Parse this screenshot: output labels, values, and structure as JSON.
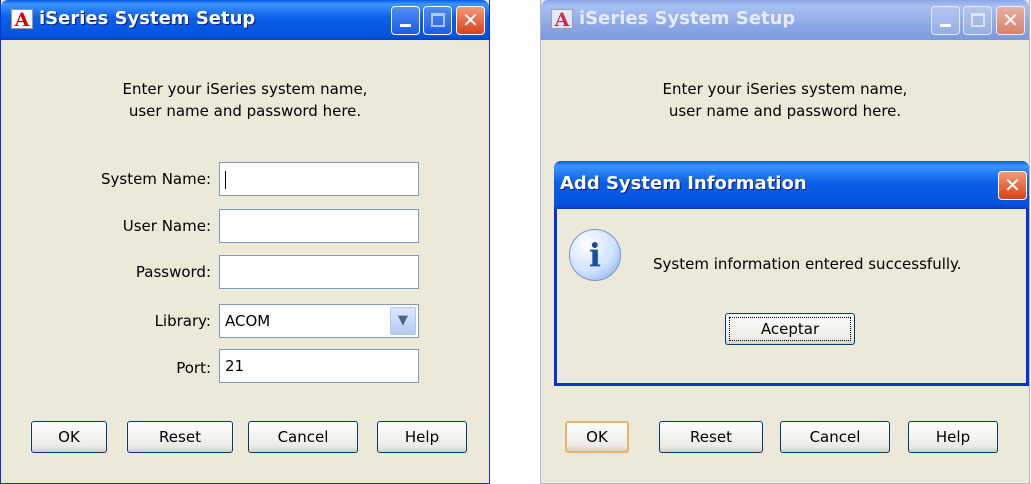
{
  "left_window": {
    "title": "iSeries System Setup",
    "app_icon": "iseries-a-logo-icon",
    "intro_line1": "Enter your iSeries system name,",
    "intro_line2": "user name and password here.",
    "fields": {
      "system_name_label": "System Name:",
      "system_name_value": "",
      "user_name_label": "User Name:",
      "user_name_value": "",
      "password_label": "Password:",
      "password_value": "",
      "library_label": "Library:",
      "library_value": "ACOM",
      "port_label": "Port:",
      "port_value": "21"
    },
    "buttons": {
      "ok": "OK",
      "reset": "Reset",
      "cancel": "Cancel",
      "help": "Help"
    }
  },
  "right_window": {
    "title": "iSeries System Setup",
    "intro_line1": "Enter your iSeries system name,",
    "intro_line2": "user name and password here.",
    "buttons": {
      "ok": "OK",
      "reset": "Reset",
      "cancel": "Cancel",
      "help": "Help"
    }
  },
  "dialog": {
    "title": "Add System Information",
    "icon": "info-icon",
    "message": "System information entered successfully.",
    "button": "Aceptar"
  },
  "colors": {
    "titlebar_active": "#0a5fe8",
    "titlebar_inactive": "#8fa9e6",
    "window_bg": "#ece9d8",
    "close_button": "#d9411b"
  }
}
